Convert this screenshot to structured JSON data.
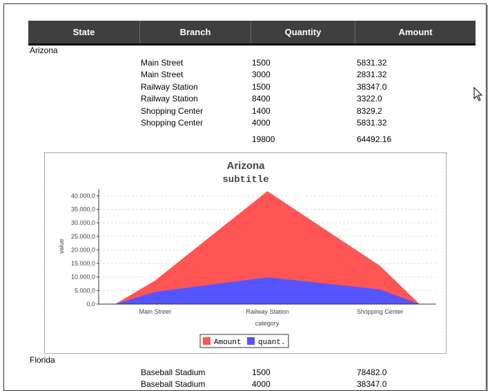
{
  "columns": [
    "State",
    "Branch",
    "Quantity",
    "Amount"
  ],
  "groups": [
    {
      "state": "Arizona",
      "rows": [
        {
          "branch": "Main Street",
          "quantity": "1500",
          "amount": "5831.32"
        },
        {
          "branch": "Main Street",
          "quantity": "3000",
          "amount": "2831.32"
        },
        {
          "branch": "Railway Station",
          "quantity": "1500",
          "amount": "38347.0"
        },
        {
          "branch": "Railway Station",
          "quantity": "8400",
          "amount": "3322.0"
        },
        {
          "branch": "Shopping Center",
          "quantity": "1400",
          "amount": "8329.2"
        },
        {
          "branch": "Shopping Center",
          "quantity": "4000",
          "amount": "5831.32"
        }
      ],
      "total_quantity": "19800",
      "total_amount": "64492.16"
    },
    {
      "state": "Florida",
      "rows": [
        {
          "branch": "Baseball Stadium",
          "quantity": "1500",
          "amount": "78482.0"
        },
        {
          "branch": "Baseball Stadium",
          "quantity": "4000",
          "amount": "38347.0"
        }
      ]
    }
  ],
  "chart_data": {
    "type": "area",
    "title": "Arizona",
    "subtitle": "subtitle",
    "xlabel": "category",
    "ylabel": "value",
    "categories": [
      "Main Street",
      "Railway Station",
      "Shopping Center"
    ],
    "series": [
      {
        "name": "Amount",
        "color": "#ff5555",
        "values": [
          8662.64,
          41669.0,
          14160.52
        ]
      },
      {
        "name": "quant.",
        "color": "#5555ff",
        "values": [
          4500,
          9900,
          5400
        ]
      }
    ],
    "ylim": [
      0,
      42500
    ],
    "yticks": [
      "0,0",
      "5.000,0",
      "10.000,0",
      "15.000,0",
      "20.000,0",
      "25.000,0",
      "30.000,0",
      "35.000,0",
      "40.000,0"
    ],
    "grid": true,
    "legend": "bottom"
  }
}
